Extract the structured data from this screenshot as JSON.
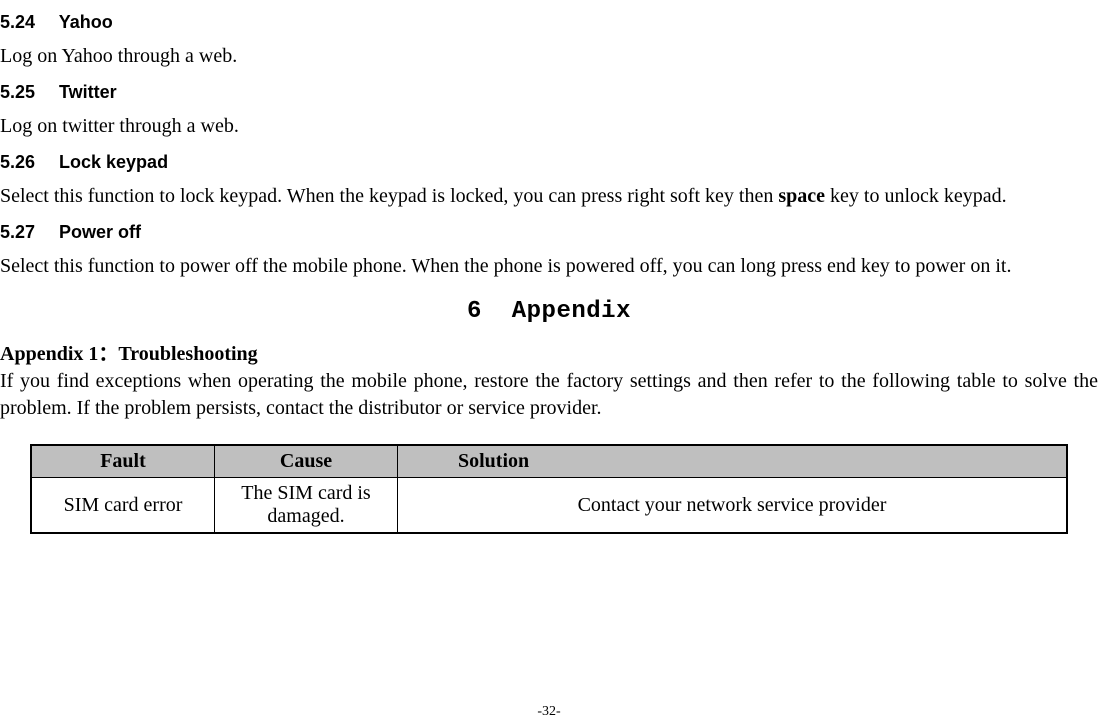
{
  "sections": {
    "s524": {
      "num": "5.24",
      "title": "Yahoo",
      "body": "Log on Yahoo through a web."
    },
    "s525": {
      "num": "5.25",
      "title": "Twitter",
      "body": "Log on twitter through a web."
    },
    "s526": {
      "num": "5.26",
      "title": "Lock keypad",
      "body_pre": "Select this function to lock keypad. When the keypad is locked, you can press right soft key then ",
      "body_bold": "space",
      "body_post": " key to unlock keypad."
    },
    "s527": {
      "num": "5.27",
      "title": "Power off",
      "body": "Select this function to power off the mobile phone. When the phone is powered off, you can long press end key to power on it."
    }
  },
  "chapter": {
    "num": "6",
    "title": "Appendix"
  },
  "appendix": {
    "title": "Appendix 1：Troubleshooting",
    "intro": "If you find exceptions when operating the mobile phone, restore the factory settings and then refer to the following table to solve the problem. If the problem persists, contact the distributor or service provider."
  },
  "table": {
    "headers": {
      "fault": "Fault",
      "cause": "Cause",
      "solution": "Solution"
    },
    "rows": [
      {
        "fault": "SIM card error",
        "cause": "The SIM card is damaged.",
        "solution": "Contact your network service provider"
      }
    ]
  },
  "page_number": "-32-"
}
